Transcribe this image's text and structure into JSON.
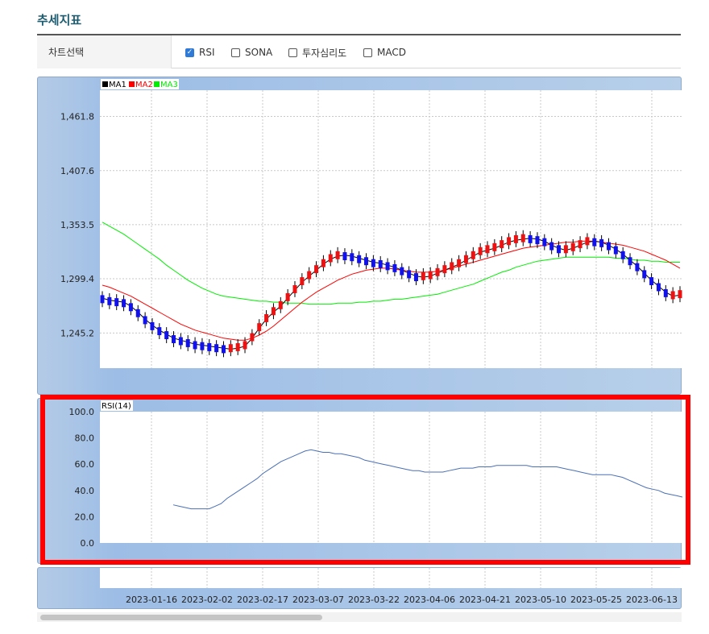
{
  "page": {
    "title": "추세지표"
  },
  "filter": {
    "label": "차트선택",
    "options": [
      {
        "label": "RSI",
        "checked": true
      },
      {
        "label": "SONA",
        "checked": false
      },
      {
        "label": "투자심리도",
        "checked": false
      },
      {
        "label": "MACD",
        "checked": false
      }
    ]
  },
  "chart_data": [
    {
      "type": "candlestick",
      "legend": [
        "MA1",
        "MA2",
        "MA3"
      ],
      "legend_colors": [
        "#000000",
        "#ff0000",
        "#00ee00"
      ],
      "y_ticks": [
        "1,461.8",
        "1,407.6",
        "1,353.5",
        "1,299.4",
        "1,245.2"
      ],
      "ylim": [
        1210,
        1488
      ],
      "up_color": "#ee1111",
      "down_color": "#1111ee",
      "ma1": [
        1280,
        1278,
        1277,
        1276,
        1272,
        1266,
        1259,
        1253,
        1248,
        1244,
        1240,
        1238,
        1236,
        1234,
        1233,
        1232,
        1231,
        1230,
        1229,
        1230,
        1232,
        1240,
        1250,
        1259,
        1266,
        1272,
        1280,
        1288,
        1296,
        1302,
        1308,
        1314,
        1319,
        1322,
        1323,
        1322,
        1320,
        1318,
        1316,
        1315,
        1313,
        1311,
        1308,
        1305,
        1302,
        1301,
        1302,
        1305,
        1308,
        1311,
        1314,
        1318,
        1322,
        1326,
        1328,
        1330,
        1333,
        1336,
        1338,
        1339,
        1340,
        1339,
        1337,
        1333,
        1330,
        1328,
        1330,
        1333,
        1336,
        1337,
        1336,
        1333,
        1329,
        1324,
        1318,
        1312,
        1305,
        1298,
        1292,
        1286,
        1282,
        1283
      ],
      "ma2": [
        1293,
        1291,
        1288,
        1285,
        1282,
        1278,
        1274,
        1270,
        1266,
        1262,
        1258,
        1254,
        1251,
        1248,
        1246,
        1244,
        1242,
        1240,
        1239,
        1238,
        1238,
        1240,
        1243,
        1247,
        1252,
        1258,
        1264,
        1270,
        1276,
        1281,
        1286,
        1290,
        1294,
        1298,
        1301,
        1304,
        1306,
        1308,
        1309,
        1310,
        1310,
        1309,
        1308,
        1307,
        1306,
        1306,
        1306,
        1307,
        1308,
        1310,
        1312,
        1314,
        1316,
        1318,
        1320,
        1322,
        1324,
        1326,
        1328,
        1330,
        1331,
        1332,
        1333,
        1334,
        1335,
        1336,
        1336,
        1337,
        1337,
        1337,
        1336,
        1335,
        1334,
        1333,
        1331,
        1329,
        1327,
        1324,
        1321,
        1318,
        1314,
        1310
      ],
      "ma3": [
        1356,
        1352,
        1348,
        1344,
        1339,
        1334,
        1329,
        1324,
        1319,
        1313,
        1308,
        1303,
        1298,
        1294,
        1290,
        1287,
        1284,
        1282,
        1281,
        1280,
        1279,
        1278,
        1277,
        1277,
        1276,
        1276,
        1275,
        1275,
        1275,
        1274,
        1274,
        1274,
        1274,
        1275,
        1275,
        1275,
        1276,
        1276,
        1277,
        1277,
        1278,
        1279,
        1279,
        1280,
        1281,
        1282,
        1283,
        1284,
        1286,
        1288,
        1290,
        1292,
        1294,
        1297,
        1300,
        1303,
        1306,
        1308,
        1311,
        1313,
        1315,
        1317,
        1318,
        1319,
        1320,
        1321,
        1321,
        1321,
        1321,
        1321,
        1321,
        1321,
        1320,
        1320,
        1319,
        1318,
        1318,
        1317,
        1317,
        1316,
        1316,
        1316
      ]
    },
    {
      "type": "line",
      "title": "RSI(14)",
      "y_ticks": [
        "100.0",
        "80.0",
        "60.0",
        "40.0",
        "20.0",
        "0.0"
      ],
      "ylim": [
        0,
        100
      ],
      "series_color": "#4a6fb5",
      "values": [
        29,
        28,
        27,
        26,
        26,
        26,
        26,
        28,
        30,
        34,
        37,
        40,
        43,
        46,
        49,
        53,
        56,
        59,
        62,
        64,
        66,
        68,
        70,
        71,
        70,
        69,
        69,
        68,
        68,
        67,
        66,
        65,
        63,
        62,
        61,
        60,
        59,
        58,
        57,
        56,
        55,
        55,
        54,
        54,
        54,
        54,
        55,
        56,
        57,
        57,
        57,
        58,
        58,
        58,
        59,
        59,
        59,
        59,
        59,
        59,
        58,
        58,
        58,
        58,
        58,
        57,
        56,
        55,
        54,
        53,
        52,
        52,
        52,
        52,
        51,
        50,
        48,
        46,
        44,
        42,
        41,
        40,
        38,
        37,
        36,
        35
      ]
    }
  ],
  "x_axis": {
    "labels": [
      "2023-01-16",
      "2023-02-02",
      "2023-02-17",
      "2023-03-07",
      "2023-03-22",
      "2023-04-06",
      "2023-04-21",
      "2023-05-10",
      "2023-05-25",
      "2023-06-13"
    ]
  },
  "colors": {
    "title": "#1d5c70",
    "panel_blue": "#9dbde6",
    "highlight": "#ff0000",
    "ma1": "#000000",
    "ma2": "#ff0000",
    "ma3": "#00ee00"
  }
}
